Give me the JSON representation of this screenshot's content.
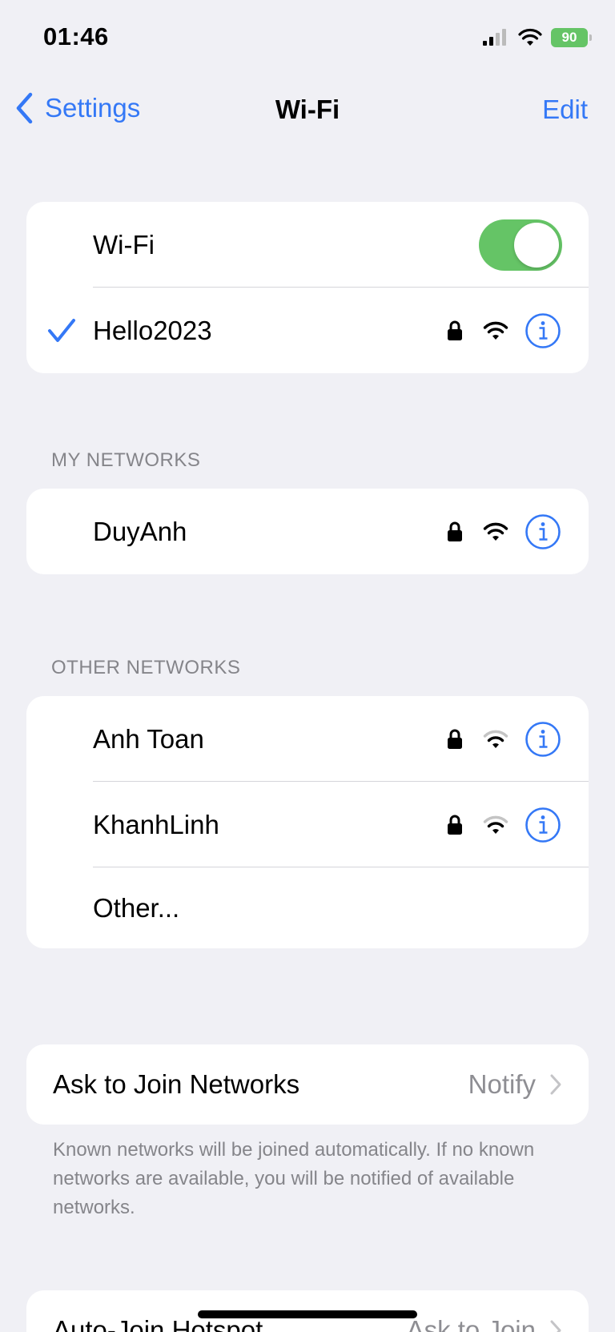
{
  "status_bar": {
    "time": "01:46",
    "battery": "90"
  },
  "nav": {
    "back_label": "Settings",
    "title": "Wi-Fi",
    "edit_label": "Edit"
  },
  "wifi_card": {
    "toggle_label": "Wi-Fi",
    "toggle_on": true,
    "connected_network": "Hello2023"
  },
  "my_networks": {
    "header": "MY NETWORKS",
    "items": [
      {
        "name": "DuyAnh"
      }
    ]
  },
  "other_networks": {
    "header": "OTHER NETWORKS",
    "items": [
      {
        "name": "Anh Toan"
      },
      {
        "name": "KhanhLinh"
      }
    ],
    "other_label": "Other..."
  },
  "ask_to_join": {
    "label": "Ask to Join Networks",
    "value": "Notify",
    "footer": "Known networks will be joined automatically. If no known networks are available, you will be notified of available networks."
  },
  "auto_join_hotspot": {
    "label": "Auto-Join Hotspot",
    "value": "Ask to Join"
  },
  "colors": {
    "accent": "#3478f6",
    "toggle_on": "#65c466",
    "background": "#f0f0f5"
  }
}
